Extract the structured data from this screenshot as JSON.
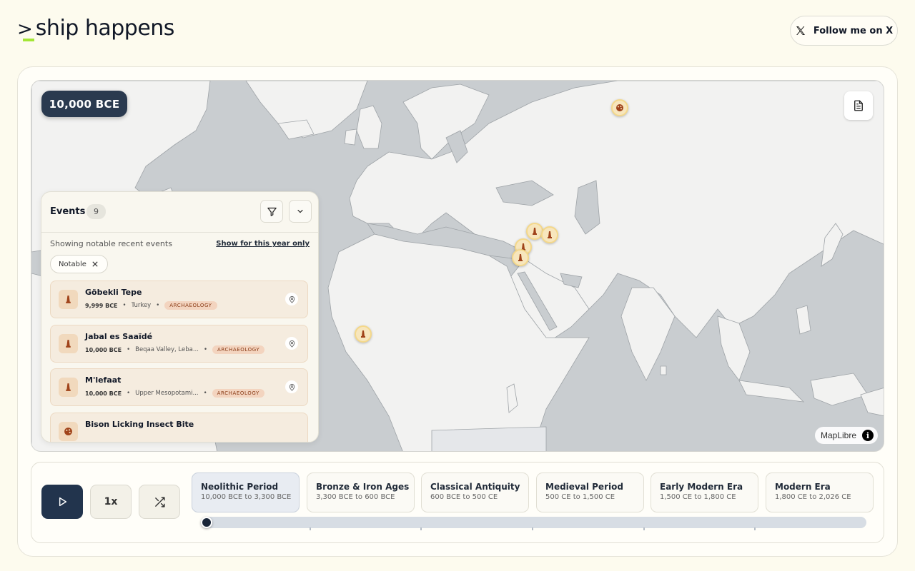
{
  "header": {
    "logo_prefix": ">",
    "logo_text": "ship happens",
    "follow_label": "Follow me on X"
  },
  "map": {
    "year_label": "10,000 BCE",
    "attribution": "MapLibre",
    "attribution_info": "i",
    "land_color": "#f2f2f1",
    "water_color": "#c9cdd0"
  },
  "events_panel": {
    "title": "Events",
    "count": "9",
    "showing_text": "Showing notable recent events",
    "year_only_link": "Show for this year only",
    "filter_chip": "Notable",
    "items": [
      {
        "name": "Göbekli Tepe",
        "year": "9,999 BCE",
        "location": "Turkey",
        "tag": "ARCHAEOLOGY",
        "icon": "monument-icon"
      },
      {
        "name": "Jabal es Saaïdé",
        "year": "10,000 BCE",
        "location": "Beqaa Valley, Leba...",
        "tag": "ARCHAEOLOGY",
        "icon": "monument-icon"
      },
      {
        "name": "M'lefaat",
        "year": "10,000 BCE",
        "location": "Upper Mesopotami...",
        "tag": "ARCHAEOLOGY",
        "icon": "monument-icon"
      },
      {
        "name": "Bison Licking Insect Bite",
        "year": "",
        "location": "",
        "tag": "",
        "icon": "palette-icon"
      }
    ]
  },
  "controls": {
    "speed_label": "1x"
  },
  "eras": [
    {
      "name": "Neolithic Period",
      "range": "10,000 BCE to 3,300 BCE",
      "active": true
    },
    {
      "name": "Bronze & Iron Ages",
      "range": "3,300 BCE to 600 BCE",
      "active": false
    },
    {
      "name": "Classical Antiquity",
      "range": "600 BCE to 500 CE",
      "active": false
    },
    {
      "name": "Medieval Period",
      "range": "500 CE to 1,500 CE",
      "active": false
    },
    {
      "name": "Early Modern Era",
      "range": "1,500 CE to 1,800 CE",
      "active": false
    },
    {
      "name": "Modern Era",
      "range": "1,800 CE to 2,026 CE",
      "active": false
    }
  ],
  "slider": {
    "progress": 0
  }
}
